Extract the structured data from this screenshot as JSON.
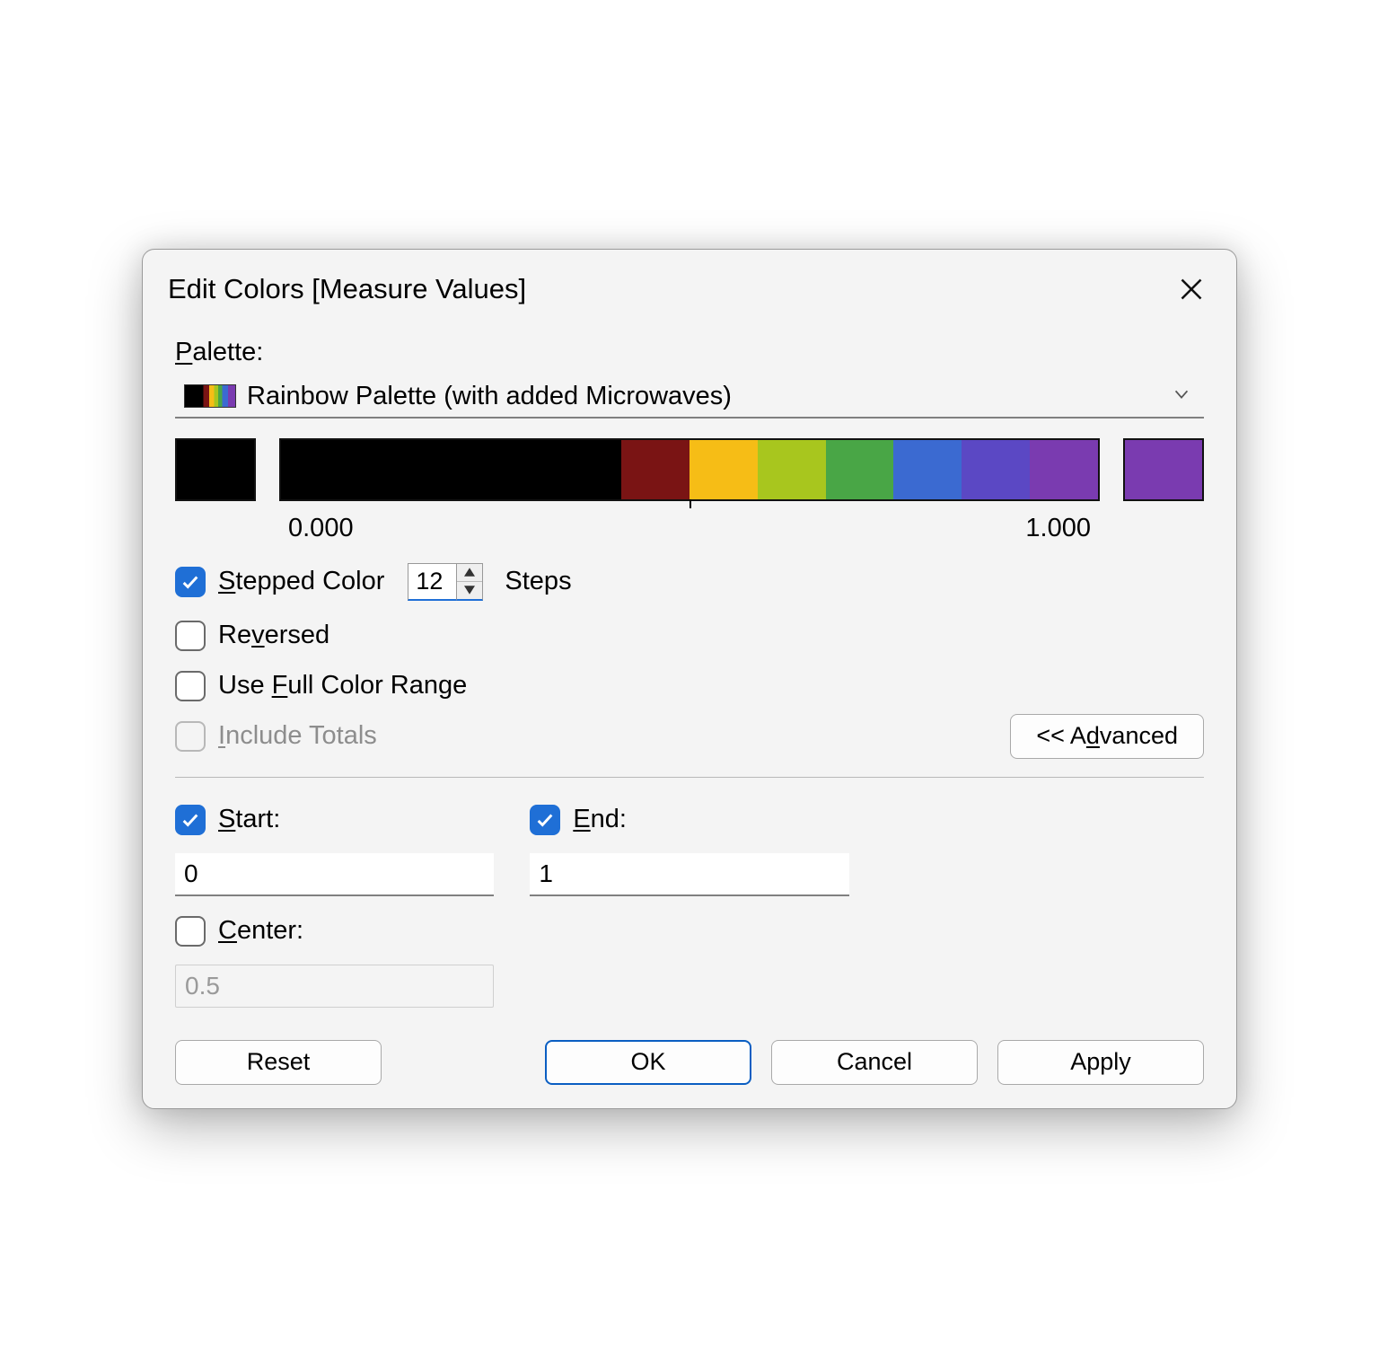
{
  "title": "Edit Colors [Measure Values]",
  "palette": {
    "section_label_pre": "P",
    "section_label_post": "alette:",
    "selected": "Rainbow Palette (with added Microwaves)"
  },
  "gradient": {
    "min_label": "0.000",
    "max_label": "1.000",
    "steps": [
      "#000000",
      "#000000",
      "#000000",
      "#000000",
      "#000000",
      "#7a1414",
      "#f6bd16",
      "#a8c61e",
      "#49a646",
      "#3b6ad1",
      "#5b48c4",
      "#7a3bb0"
    ],
    "start_color": "#000000",
    "end_color": "#7a3bb0",
    "center_tick": 0.5
  },
  "options": {
    "stepped": {
      "checked": true,
      "label_pre": "S",
      "label_post": "tepped Color",
      "value": "12",
      "units": "Steps"
    },
    "reversed": {
      "checked": false,
      "label_pre": "Re",
      "label_u": "v",
      "label_post": "ersed"
    },
    "full_range": {
      "checked": false,
      "label_pre": "Use ",
      "label_u": "F",
      "label_post": "ull Color Range"
    },
    "include_totals": {
      "checked": false,
      "disabled": true,
      "label_pre": "",
      "label_u": "I",
      "label_post": "nclude Totals"
    },
    "advanced_label_pre": "<< A",
    "advanced_label_u": "d",
    "advanced_label_post": "vanced"
  },
  "range": {
    "start": {
      "checked": true,
      "label_u": "S",
      "label_post": "tart:",
      "value": "0"
    },
    "end": {
      "checked": true,
      "label_u": "E",
      "label_post": "nd:",
      "value": "1"
    },
    "center": {
      "checked": false,
      "label_u": "C",
      "label_post": "enter:",
      "value": "0.5"
    }
  },
  "buttons": {
    "reset": "Reset",
    "ok": "OK",
    "cancel": "Cancel",
    "apply": "Apply"
  }
}
